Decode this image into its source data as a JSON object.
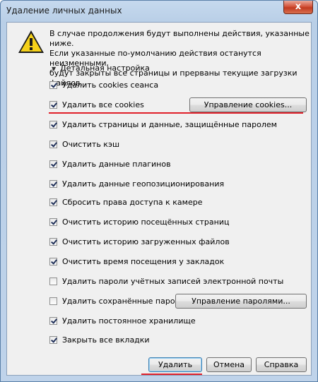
{
  "window": {
    "title": "Удаление личных данных",
    "close_glyph": "x"
  },
  "message": "В случае продолжения будут выполнены действия, указанные ниже.\nЕсли указанные по-умолчанию действия останутся неизменными,\nбудут закрыты все страницы и прерваны текущие загрузки файлов.",
  "details_toggle": "Детальная настройка",
  "options": [
    {
      "label": "Удалить cookies сеанса",
      "checked": true
    },
    {
      "label": "Удалить все cookies",
      "checked": true
    },
    {
      "label": "Удалить страницы и данные, защищённые паролем",
      "checked": true
    },
    {
      "label": "Очистить кэш",
      "checked": true
    },
    {
      "label": "Удалить данные плагинов",
      "checked": true
    },
    {
      "label": "Удалить данные геопозиционирования",
      "checked": true
    },
    {
      "label": "Сбросить права доступа к камере",
      "checked": true
    },
    {
      "label": "Очистить историю посещённых страниц",
      "checked": true
    },
    {
      "label": "Очистить историю загруженных файлов",
      "checked": true
    },
    {
      "label": "Очистить время посещения у закладок",
      "checked": true
    },
    {
      "label": "Удалить пароли учётных записей электронной почты",
      "checked": false
    },
    {
      "label": "Удалить сохранённые пароли",
      "checked": false
    },
    {
      "label": "Удалить постоянное хранилище",
      "checked": true
    },
    {
      "label": "Закрыть все вкладки",
      "checked": true
    }
  ],
  "buttons": {
    "manage_cookies": "Управление cookies...",
    "manage_passwords": "Управление паролями...",
    "delete": "Удалить",
    "cancel": "Отмена",
    "help": "Справка"
  },
  "icons": {
    "warning": "warning-icon",
    "close": "close-icon",
    "expand": "triangle-down-icon"
  },
  "colors": {
    "highlight_underline": "#e0202a",
    "title_bar": "#b9cfe7"
  }
}
